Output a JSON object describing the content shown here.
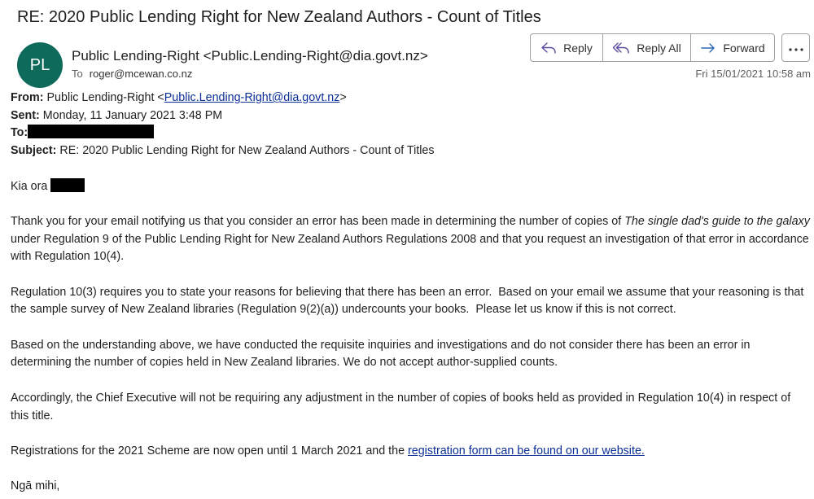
{
  "header": {
    "subject_title": "RE: 2020 Public Lending Right for New Zealand Authors - Count of Titles",
    "avatar_initials": "PL",
    "sender": "Public Lending-Right <Public.Lending-Right@dia.govt.nz>",
    "to_label": "To",
    "to_address": "roger@mcewan.co.nz",
    "date": "Fri 15/01/2021 10:58 am"
  },
  "actions": {
    "reply": "Reply",
    "reply_all": "Reply All",
    "forward": "Forward"
  },
  "quoted": {
    "from_label": "From:",
    "from_name": "Public Lending-Right <",
    "from_email": "Public.Lending-Right@dia.govt.nz",
    "from_close": ">",
    "sent_label": "Sent:",
    "sent_value": "Monday, 11 January 2021 3:48 PM",
    "to_label": "To:",
    "subject_label": "Subject:",
    "subject_value": "RE: 2020 Public Lending Right for New Zealand Authors - Count of Titles"
  },
  "body": {
    "greeting": "Kia ora",
    "p1_a": "Thank you for your email notifying us that you consider an error has been made in determining the number of copies of ",
    "p1_title": "The single dad's guide to the galaxy",
    "p1_b": " under Regulation 9 of the Public Lending Right for New Zealand Authors Regulations 2008 and that you request an investigation of that error in accordance with Regulation 10(4).",
    "p2": "Regulation 10(3) requires you to state your reasons for believing that there has been an error.  Based on your email we assume that your reasoning is that the sample survey of New Zealand libraries (Regulation 9(2)(a)) undercounts your books.  Please let us know if this is not correct.",
    "p3": "Based on the understanding above, we have conducted the requisite inquiries and investigations and do not consider there has been an error in determining the number of copies held in New Zealand libraries. We do not accept author-supplied counts.",
    "p4": "Accordingly, the Chief Executive will not be requiring any adjustment in the number of copies of books held as provided in Regulation 10(4) in respect of this title.",
    "p5_a": "Registrations for the 2021 Scheme are now open until 1 March 2021 and the ",
    "p5_link": "registration form can be found on our website.",
    "signoff": "Ngā mihi,"
  }
}
